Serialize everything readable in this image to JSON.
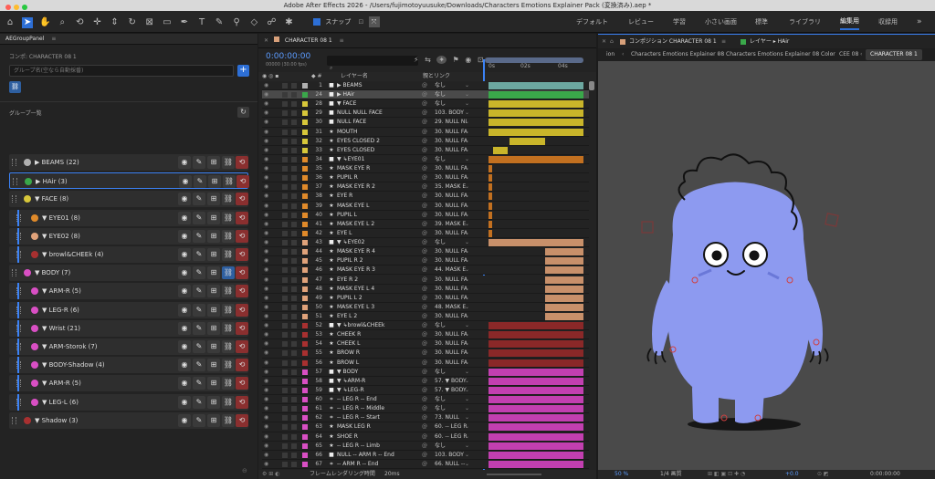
{
  "title": "Adobe After Effects 2026 - /Users/fujimotoyuusuke/Downloads/Characters Emotions Explainer Pack (変換済み).aep *",
  "toolbar": {
    "snap_label": "スナップ"
  },
  "workspaces": [
    "デフォルト",
    "レビュー",
    "学習",
    "小さい画面",
    "標準",
    "ライブラリ",
    "編集用",
    "収録用"
  ],
  "left": {
    "panel_title": "AEGroupPanel",
    "comp_label": "コンポ: CHARACTER 08 1",
    "group_name_placeholder": "グループ名(空なら自動採番)",
    "group_list_label": "グループ一覧",
    "groups": [
      {
        "name": "BEAMS (22)",
        "color": "#b0b0b0",
        "indent": 0,
        "arrow": "▶"
      },
      {
        "name": "HAir (3)",
        "color": "#3aa84a",
        "indent": 0,
        "arrow": "▶"
      },
      {
        "name": "FACE (8)",
        "color": "#d7c73a",
        "indent": 0,
        "arrow": "▼"
      },
      {
        "name": "EYE01 (8)",
        "color": "#e08a2a",
        "indent": 1,
        "arrow": "▼"
      },
      {
        "name": "EYE02 (8)",
        "color": "#e0a27a",
        "indent": 1,
        "arrow": "▼"
      },
      {
        "name": "browl&CHEEk (4)",
        "color": "#a83030",
        "indent": 1,
        "arrow": "▼"
      },
      {
        "name": "BODY (7)",
        "color": "#d94fc4",
        "indent": 0,
        "arrow": "▼"
      },
      {
        "name": "ARM-R (5)",
        "color": "#d94fc4",
        "indent": 1,
        "arrow": "▼"
      },
      {
        "name": "LEG-R (6)",
        "color": "#d94fc4",
        "indent": 1,
        "arrow": "▼"
      },
      {
        "name": "Wrist (21)",
        "color": "#d94fc4",
        "indent": 1,
        "arrow": "▼"
      },
      {
        "name": "ARM-Storok (7)",
        "color": "#d94fc4",
        "indent": 1,
        "arrow": "▼"
      },
      {
        "name": "BODY-Shadow (4)",
        "color": "#d94fc4",
        "indent": 1,
        "arrow": "▼"
      },
      {
        "name": "ARM-R (5)",
        "color": "#d94fc4",
        "indent": 1,
        "arrow": "▼"
      },
      {
        "name": "LEG-L (6)",
        "color": "#d94fc4",
        "indent": 1,
        "arrow": "▼"
      },
      {
        "name": "Shadow (3)",
        "color": "#a83030",
        "indent": 0,
        "arrow": "▼"
      }
    ]
  },
  "timeline": {
    "tab": "CHARACTER 08 1",
    "timecode": "0:00:00:00",
    "fps": "00000 (30.00 fps)",
    "col_layer": "レイヤー名",
    "col_parent": "親とリンク",
    "ruler": [
      "0s",
      "02s",
      "04s"
    ],
    "footer": "フレームレンダリング時間",
    "footer_val": "20ms",
    "layers": [
      {
        "n": "1",
        "name": "▶ BEAMS",
        "parent": "なし",
        "c": "#b0b0b0",
        "bar": [
          0,
          100
        ],
        "bc": "#6ca8a0",
        "ic": "■"
      },
      {
        "n": "24",
        "name": "▶ HAir",
        "parent": "なし",
        "c": "#3aa84a",
        "bar": [
          0,
          100
        ],
        "bc": "#3aa84a",
        "ic": "■",
        "sel": true
      },
      {
        "n": "28",
        "name": "▼ FACE",
        "parent": "なし",
        "c": "#d7c73a",
        "bar": [
          0,
          100
        ],
        "bc": "#c9b52a",
        "ic": "■"
      },
      {
        "n": "29",
        "name": "NULL NULL FACE",
        "parent": "103. BODY",
        "c": "#d7c73a",
        "bar": [
          0,
          100
        ],
        "bc": "#c9b52a",
        "ic": "■"
      },
      {
        "n": "30",
        "name": "NULL FACE",
        "parent": "29. NULL NI",
        "c": "#d7c73a",
        "bar": [
          0,
          100
        ],
        "bc": "#c9b52a",
        "ic": "■"
      },
      {
        "n": "31",
        "name": "MOUTH",
        "parent": "30. NULL FA",
        "c": "#d7c73a",
        "bar": [
          0,
          100
        ],
        "bc": "#c9b52a",
        "ic": "★"
      },
      {
        "n": "32",
        "name": "EYES CLOSED 2",
        "parent": "30. NULL FA",
        "c": "#d7c73a",
        "bar": [
          22,
          60
        ],
        "bc": "#c9b52a",
        "ic": "★"
      },
      {
        "n": "33",
        "name": "EYES CLOSED",
        "parent": "30. NULL FA",
        "c": "#d7c73a",
        "bar": [
          5,
          20
        ],
        "bc": "#c9b52a",
        "ic": "★"
      },
      {
        "n": "34",
        "name": "▼ ↳EYE01",
        "parent": "なし",
        "c": "#e08a2a",
        "bar": [
          0,
          100
        ],
        "bc": "#c27020",
        "ic": "■"
      },
      {
        "n": "35",
        "name": "MASK EYE R",
        "parent": "30. NULL FA",
        "c": "#e08a2a",
        "bar": [
          0,
          4
        ],
        "bc": "#c27020",
        "ic": "★"
      },
      {
        "n": "36",
        "name": "PUPIL R",
        "parent": "30. NULL FA",
        "c": "#e08a2a",
        "bar": [
          0,
          4
        ],
        "bc": "#c27020",
        "ic": "★"
      },
      {
        "n": "37",
        "name": "MASK EYE R 2",
        "parent": "35. MASK E",
        "c": "#e08a2a",
        "bar": [
          0,
          4
        ],
        "bc": "#c27020",
        "ic": "★"
      },
      {
        "n": "38",
        "name": "EYE R",
        "parent": "30. NULL FA",
        "c": "#e08a2a",
        "bar": [
          0,
          4
        ],
        "bc": "#c27020",
        "ic": "★"
      },
      {
        "n": "39",
        "name": "MASK EYE L",
        "parent": "30. NULL FA",
        "c": "#e08a2a",
        "bar": [
          0,
          4
        ],
        "bc": "#c27020",
        "ic": "★"
      },
      {
        "n": "40",
        "name": "PUPIL L",
        "parent": "30. NULL FA",
        "c": "#e08a2a",
        "bar": [
          0,
          4
        ],
        "bc": "#c27020",
        "ic": "★"
      },
      {
        "n": "41",
        "name": "MASK EYE L 2",
        "parent": "39. MASK E",
        "c": "#e08a2a",
        "bar": [
          0,
          4
        ],
        "bc": "#c27020",
        "ic": "★"
      },
      {
        "n": "42",
        "name": "EYE L",
        "parent": "30. NULL FA",
        "c": "#e08a2a",
        "bar": [
          0,
          4
        ],
        "bc": "#c27020",
        "ic": "★"
      },
      {
        "n": "43",
        "name": "▼ ↳EYE02",
        "parent": "なし",
        "c": "#e0a27a",
        "bar": [
          0,
          100
        ],
        "bc": "#c8906a",
        "ic": "■"
      },
      {
        "n": "44",
        "name": "MASK EYE R 4",
        "parent": "30. NULL FA",
        "c": "#e0a27a",
        "bar": [
          60,
          100
        ],
        "bc": "#c8906a",
        "ic": "★"
      },
      {
        "n": "45",
        "name": "PUPIL R 2",
        "parent": "30. NULL FA",
        "c": "#e0a27a",
        "bar": [
          60,
          100
        ],
        "bc": "#c8906a",
        "ic": "★"
      },
      {
        "n": "46",
        "name": "MASK EYE R 3",
        "parent": "44. MASK E",
        "c": "#e0a27a",
        "bar": [
          60,
          100
        ],
        "bc": "#c8906a",
        "ic": "★"
      },
      {
        "n": "47",
        "name": "EYE R 2",
        "parent": "30. NULL FA",
        "c": "#e0a27a",
        "bar": [
          60,
          100
        ],
        "bc": "#c8906a",
        "ic": "★"
      },
      {
        "n": "48",
        "name": "MASK EYE L 4",
        "parent": "30. NULL FA",
        "c": "#e0a27a",
        "bar": [
          60,
          100
        ],
        "bc": "#c8906a",
        "ic": "★"
      },
      {
        "n": "49",
        "name": "PUPIL L 2",
        "parent": "30. NULL FA",
        "c": "#e0a27a",
        "bar": [
          60,
          100
        ],
        "bc": "#c8906a",
        "ic": "★"
      },
      {
        "n": "50",
        "name": "MASK EYE L 3",
        "parent": "48. MASK E",
        "c": "#e0a27a",
        "bar": [
          60,
          100
        ],
        "bc": "#c8906a",
        "ic": "★"
      },
      {
        "n": "51",
        "name": "EYE L 2",
        "parent": "30. NULL FA",
        "c": "#e0a27a",
        "bar": [
          60,
          100
        ],
        "bc": "#c8906a",
        "ic": "★"
      },
      {
        "n": "52",
        "name": "▼ ↳browl&CHEEk",
        "parent": "なし",
        "c": "#a83030",
        "bar": [
          0,
          100
        ],
        "bc": "#8a2828",
        "ic": "■"
      },
      {
        "n": "53",
        "name": "CHEEK R",
        "parent": "30. NULL FA",
        "c": "#a83030",
        "bar": [
          0,
          100
        ],
        "bc": "#8a2828",
        "ic": "★"
      },
      {
        "n": "54",
        "name": "CHEEK L",
        "parent": "30. NULL FA",
        "c": "#a83030",
        "bar": [
          0,
          100
        ],
        "bc": "#8a2828",
        "ic": "★"
      },
      {
        "n": "55",
        "name": "BROW R",
        "parent": "30. NULL FA",
        "c": "#a83030",
        "bar": [
          0,
          100
        ],
        "bc": "#8a2828",
        "ic": "★"
      },
      {
        "n": "56",
        "name": "BROW L",
        "parent": "30. NULL FA",
        "c": "#a83030",
        "bar": [
          0,
          100
        ],
        "bc": "#8a2828",
        "ic": "★"
      },
      {
        "n": "57",
        "name": "▼ BODY",
        "parent": "なし",
        "c": "#d94fc4",
        "bar": [
          0,
          100
        ],
        "bc": "#c23fb0",
        "ic": "■"
      },
      {
        "n": "58",
        "name": "▼ ↳ARM-R",
        "parent": "57. ▼ BODY",
        "c": "#d94fc4",
        "bar": [
          0,
          100
        ],
        "bc": "#c23fb0",
        "ic": "■"
      },
      {
        "n": "59",
        "name": "▼ ↳LEG-R",
        "parent": "57. ▼ BODY",
        "c": "#d94fc4",
        "bar": [
          0,
          100
        ],
        "bc": "#c23fb0",
        "ic": "■"
      },
      {
        "n": "60",
        "name": "-- LEG R -- End",
        "parent": "なし",
        "c": "#d94fc4",
        "bar": [
          0,
          100
        ],
        "bc": "#c23fb0",
        "ic": "⌗"
      },
      {
        "n": "61",
        "name": "-- LEG R -- Middle",
        "parent": "なし",
        "c": "#d94fc4",
        "bar": [
          0,
          100
        ],
        "bc": "#c23fb0",
        "ic": "⌗"
      },
      {
        "n": "62",
        "name": "-- LEG R -- Start",
        "parent": "73. NULL",
        "c": "#d94fc4",
        "bar": [
          0,
          100
        ],
        "bc": "#c23fb0",
        "ic": "⌗"
      },
      {
        "n": "63",
        "name": "MASK LEG R",
        "parent": "60. -- LEG R",
        "c": "#d94fc4",
        "bar": [
          0,
          100
        ],
        "bc": "#c23fb0",
        "ic": "★"
      },
      {
        "n": "64",
        "name": "SHOE R",
        "parent": "60. -- LEG R",
        "c": "#d94fc4",
        "bar": [
          0,
          100
        ],
        "bc": "#c23fb0",
        "ic": "★"
      },
      {
        "n": "65",
        "name": "-- LEG R -- Limb",
        "parent": "なし",
        "c": "#d94fc4",
        "bar": [
          0,
          100
        ],
        "bc": "#c23fb0",
        "ic": "★"
      },
      {
        "n": "66",
        "name": "NULL -- ARM R -- End",
        "parent": "103. BODY",
        "c": "#d94fc4",
        "bar": [
          0,
          100
        ],
        "bc": "#c23fb0",
        "ic": "■"
      },
      {
        "n": "67",
        "name": "-- ARM R -- End",
        "parent": "66. NULL --",
        "c": "#d94fc4",
        "bar": [
          0,
          100
        ],
        "bc": "#c23fb0",
        "ic": "⌗"
      }
    ]
  },
  "viewer": {
    "comp_tab": "コンポジション CHARACTER 08 1",
    "layer_tab": "レイヤー ▸ HAir",
    "crumbs": [
      "ion",
      "Characters Emotions Explainer 08",
      "Characters Emotions Explainer 08 Color",
      "CEE 08",
      "CHARACTER 08 1"
    ],
    "zoom": "50 %",
    "quality": "1/4 画質",
    "exposure": "+0.0",
    "timecode": "0:00:00:00"
  }
}
